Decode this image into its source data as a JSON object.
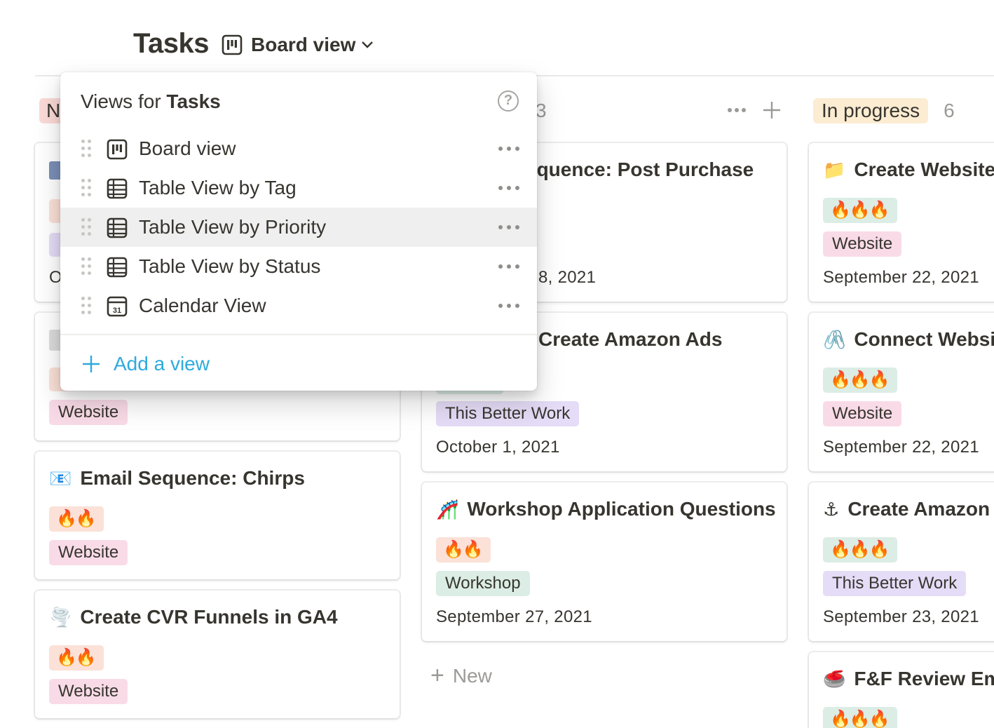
{
  "page": {
    "title": "Tasks"
  },
  "view_switcher": {
    "label": "Board view",
    "icon": "board-icon"
  },
  "columns": [
    {
      "status": "N",
      "color": "#fbdad7",
      "count": ""
    },
    {
      "status": "",
      "count": "3"
    },
    {
      "status": "In progress",
      "color": "#fbecd2",
      "count": "6"
    }
  ],
  "column_left": {
    "cards": [
      {
        "title": "",
        "icon": "document-icon",
        "tags": [
          "",
          ""
        ],
        "date_fragment": "O"
      },
      {
        "title": "",
        "icon": "calendar-icon",
        "tags": [
          "Website"
        ]
      },
      {
        "title": "Email Sequence: Chirps",
        "emoji": "📧",
        "priority": "🔥🔥",
        "tag": "Website"
      },
      {
        "title": "Create CVR Funnels in GA4",
        "emoji": "🌪️",
        "priority": "🔥🔥",
        "tag": "Website"
      }
    ]
  },
  "column_middle": {
    "cards": [
      {
        "title": "equence: Post Purchase",
        "date": "8, 2021"
      },
      {
        "title": "Create Amazon Ads",
        "tag": "This Better Work",
        "date": "October 1, 2021"
      },
      {
        "title": "Workshop Application Questions",
        "emoji": "🎢",
        "priority": "🔥🔥",
        "tag": "Workshop",
        "date": "September 27, 2021"
      }
    ],
    "new_label": "New"
  },
  "column_right": {
    "cards": [
      {
        "title": "Create Website",
        "emoji": "📁",
        "priority": "🔥🔥🔥",
        "tag": "Website",
        "date": "September 22, 2021"
      },
      {
        "title": "Connect Websit",
        "emoji": "🖇️",
        "priority": "🔥🔥🔥",
        "tag": "Website",
        "date": "September 22, 2021"
      },
      {
        "title": "Create Amazon",
        "emoji": "⚓",
        "priority": "🔥🔥🔥",
        "tag": "This Better Work",
        "date": "September 23, 2021"
      },
      {
        "title": "F&F Review Ema",
        "emoji": "🥌",
        "priority": "🔥🔥🔥"
      }
    ]
  },
  "dropdown": {
    "title_prefix": "Views for",
    "title_bold": "Tasks",
    "help": "?",
    "views": [
      {
        "label": "Board view",
        "icon": "board-icon"
      },
      {
        "label": "Table View by Tag",
        "icon": "table-icon"
      },
      {
        "label": "Table View by Priority",
        "icon": "table-icon"
      },
      {
        "label": "Table View by Status",
        "icon": "table-icon"
      },
      {
        "label": "Calendar View",
        "icon": "calendar-icon",
        "icon_text": "31"
      }
    ],
    "add_label": "Add a view"
  },
  "colors": {
    "tag_website": "#f9dbe7",
    "tag_this_better_work": "#e5dcf7",
    "tag_workshop": "#dbede4",
    "priority_two": "#fbe1d7",
    "priority_three": "#dbede4",
    "accent_blue": "#2eaadc"
  }
}
